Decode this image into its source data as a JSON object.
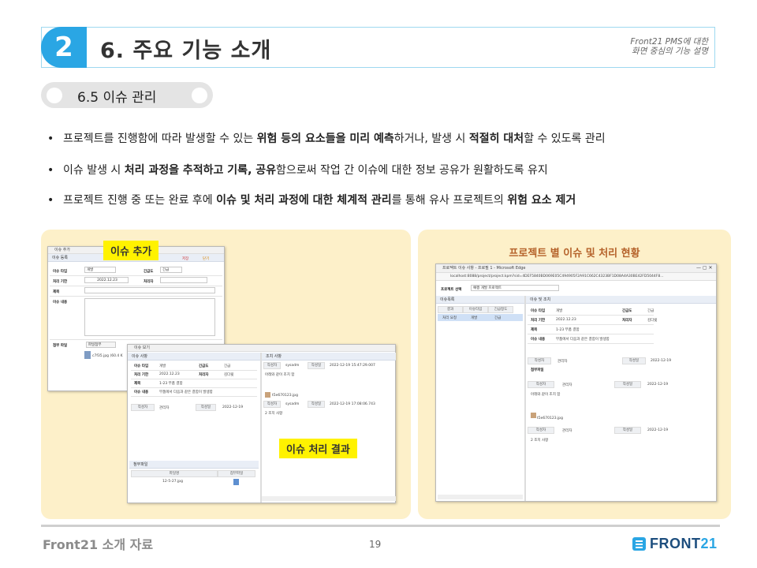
{
  "header": {
    "number": "2",
    "title": "6. 주요 기능 소개",
    "subtitle_line1": "Front21 PMS에 대한",
    "subtitle_line2": "화면 중심의 기능 설명"
  },
  "section": {
    "label": "6.5 이슈 관리"
  },
  "bullets": [
    [
      {
        "t": "프로젝트를 진행함에 따라 발생할 수 있는 ",
        "b": false
      },
      {
        "t": "위험 등의 요소들을 미리 예측",
        "b": true
      },
      {
        "t": "하거나, 발생 시 ",
        "b": false
      },
      {
        "t": "적절히 대처",
        "b": true
      },
      {
        "t": "할 수 있도록 관리",
        "b": false
      }
    ],
    [
      {
        "t": "이슈 발생 시 ",
        "b": false
      },
      {
        "t": "처리 과정을 추적하고 기록, 공유",
        "b": true
      },
      {
        "t": "함으로써 작업 간 이슈에 대한 정보 공유가 원활하도록 유지",
        "b": false
      }
    ],
    [
      {
        "t": "프로젝트 진행 중 또는 완료 후에 ",
        "b": false
      },
      {
        "t": "이슈 및 처리 과정에 대한 체계적 관리",
        "b": true
      },
      {
        "t": "를 통해 유사 프로젝트의 ",
        "b": false
      },
      {
        "t": "위험 요소 제거",
        "b": true
      }
    ]
  ],
  "left_panel": {
    "tag_add": "이슈 추가",
    "tag_result": "이슈 처리 결과",
    "win_add": {
      "title": "이슈 추가",
      "bar": "이슈 등록",
      "save": "저장",
      "close": "닫기",
      "labels": [
        "이슈 타입",
        "처리 기한",
        "제목",
        "이슈 내용",
        "첨부 파일"
      ],
      "type_value": "개발",
      "date_value": "2022.12.23",
      "urgency_label": "긴급도",
      "urgency_value": "긴급",
      "handler_label": "처리자",
      "attach_button": "파일첨부",
      "attach_file": "c7f35.jpg (60.4 K"
    },
    "win_view": {
      "title": "이슈 보기",
      "bar_left": "이슈 사항",
      "bar_right": "조치 사항",
      "rows": [
        {
          "k": "이슈 타입",
          "v": "개발",
          "k2": "긴급도",
          "v2": "긴급"
        },
        {
          "k": "처리 기한",
          "v": "2022.12.23",
          "k2": "처리자",
          "v2": "김다윗"
        },
        {
          "k": "제목",
          "v": "1-23 부품 결함",
          "k2": "",
          "v2": ""
        },
        {
          "k": "이슈 내용",
          "v": "부품에서 다음과 같은 결함이 발생함",
          "k2": "",
          "v2": ""
        }
      ],
      "author_label": "작성자",
      "author": "관리자",
      "date_label": "작성일",
      "date": "2022-12-19",
      "files_bar": "첨부파일",
      "file_col1": "파일명",
      "file_col2": "첨부파일",
      "file_name": "12-5-27.jpg",
      "r_author": "sysadm",
      "r_date1": "2022-12-19 15:47:29.007",
      "r_text1": "아래와 같이 조치 함",
      "r_img": "t5e670123.jpg",
      "r_date2": "2022-12-19 17:08:06.743",
      "r_text2": "2 조치 사항"
    }
  },
  "right_panel": {
    "title": "프로젝트 별 이슈 및 처리 현황",
    "browser_title": "프로젝트 이슈 사항 - 프로필 1 - Microsoft Edge",
    "url": "localhost:8088/project/project.kpm?sid=4DEF5840BD069E05C494905F2A91C662C4323BF1D08A4A30BE42FD5044F8...",
    "project_select_label": "프로젝트 선택",
    "project_select_value": "예쩡 개발 프로젝트",
    "list_bar": "이슈목록",
    "list_cols": [
      "결과",
      "이슈타입",
      "긴급정도"
    ],
    "list_row": [
      "처리 요청",
      "개발",
      "긴급"
    ],
    "detail_bar": "이슈 및 조치",
    "rows": [
      {
        "k": "이슈 타입",
        "v": "개발",
        "k2": "긴급도",
        "v2": "긴급"
      },
      {
        "k": "처리 기한",
        "v": "2022.12.23",
        "k2": "처리자",
        "v2": "김다윗"
      },
      {
        "k": "제목",
        "v": "1-23 부품 결함",
        "k2": "",
        "v2": ""
      },
      {
        "k": "이슈 내용",
        "v": "부품에서 다음과 같은 결함이 발생함",
        "k2": "",
        "v2": ""
      }
    ],
    "author_label": "작성자",
    "author": "관리자",
    "date_label": "작성일",
    "date": "2022-12-19",
    "attach_label": "첨부파일",
    "action_text1": "아래와 같이 조치 함",
    "action_img": "t5e670123.jpg",
    "action_text2": "2 조치 사항"
  },
  "footer": {
    "left": "Front21 소개 자료",
    "page": "19",
    "logo_a": "FRONT",
    "logo_b": "21"
  }
}
